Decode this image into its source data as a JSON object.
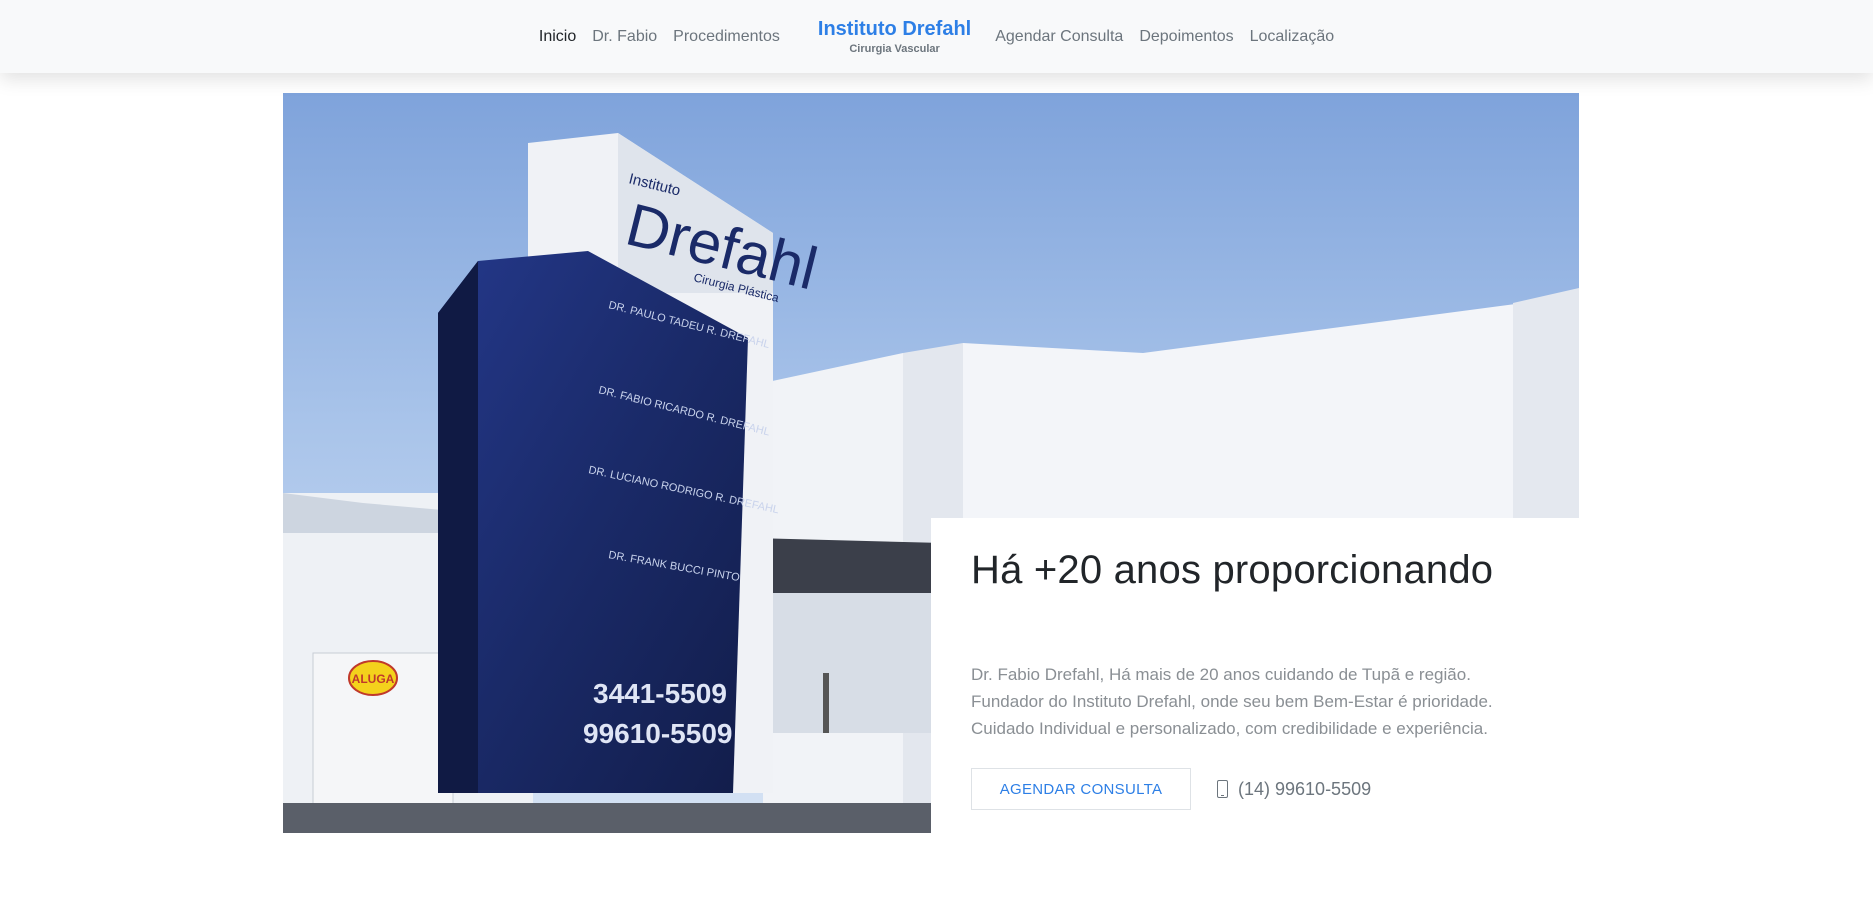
{
  "nav": {
    "left_links": [
      "Inicio",
      "Dr. Fabio",
      "Procedimentos"
    ],
    "brand_title": "Instituto Drefahl",
    "brand_subtitle": "Cirurgia Vascular",
    "right_links": [
      "Agendar Consulta",
      "Depoimentos",
      "Localização"
    ],
    "active": "Inicio"
  },
  "hero": {
    "photo": {
      "sign_lines": [
        "Instituto",
        "Drefahl",
        "Cirurgia Plástica"
      ],
      "panel_lines": [
        "DR. PAULO TADEU R. DREFAHL",
        "DR. FABIO RICARDO R. DREFAHL",
        "DR. LUCIANO RODRIGO R. DREFAHL",
        "DR. FRANK BUCCI PINTO"
      ],
      "phones": [
        "3441-5509",
        "99610-5509"
      ],
      "door_sticker": [
        "ALUGA"
      ]
    },
    "title": "Há +20 anos proporcionando",
    "text_lines": [
      "Dr. Fabio Drefahl, Há mais de 20 anos cuidando de Tupã e região.",
      "Fundador do Instituto Drefahl, onde seu bem Bem-Estar é prioridade.",
      "Cuidado Individual e personalizado, com credibilidade e experiência."
    ],
    "cta_label": "AGENDAR CONSULTA",
    "phone": "(14) 99610-5509"
  },
  "colors": {
    "accent": "#2d7fe6",
    "nav_bg": "#f8f9fa",
    "sign_blue": "#1c2f6e",
    "sky": "#8fb1e3"
  },
  "icons": {
    "phone": "mobile-phone-icon"
  }
}
